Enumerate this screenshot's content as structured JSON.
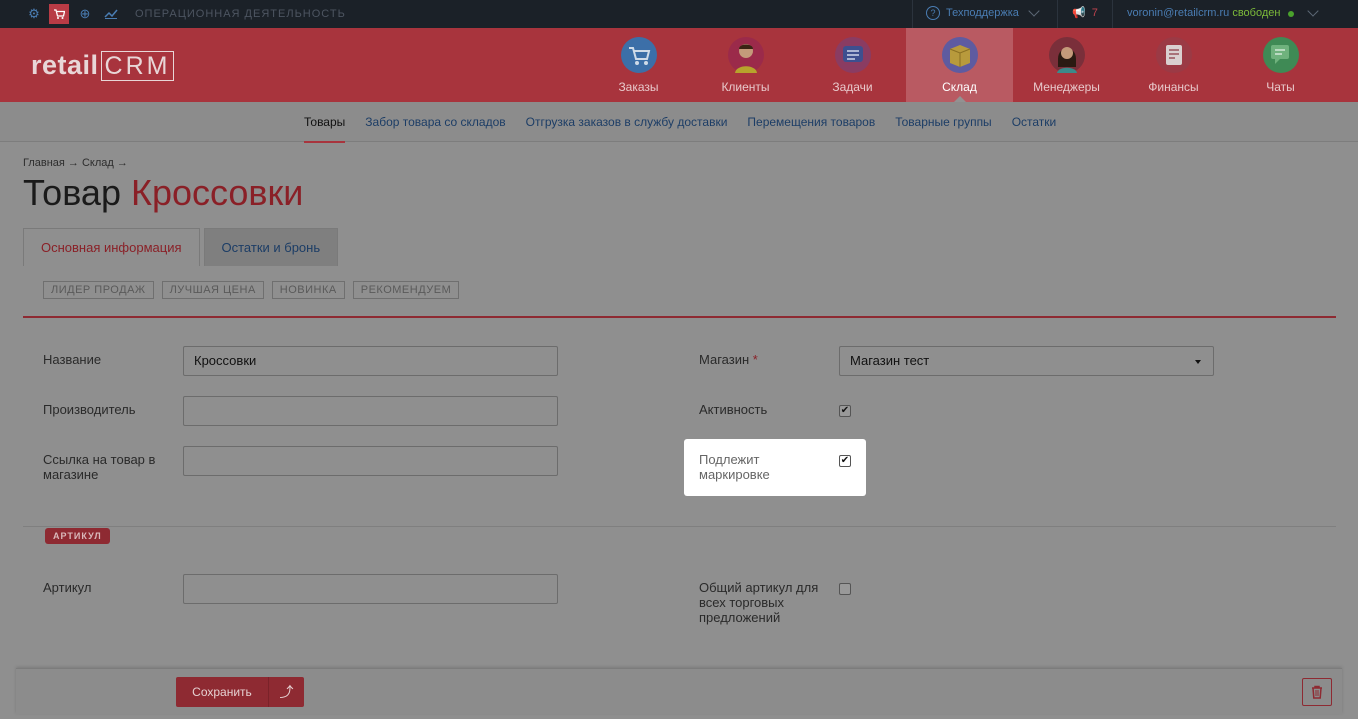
{
  "topbar": {
    "section_title": "ОПЕРАЦИОННАЯ ДЕЯТЕЛЬНОСТЬ",
    "support_label": "Техподдержка",
    "notifications_count": "7",
    "user_email": "voronin@retailcrm.ru",
    "user_status": "свободен"
  },
  "logo": {
    "text": "retail",
    "crm": "CRM"
  },
  "nav": [
    {
      "label": "Заказы",
      "icon": "cart-icon",
      "color": "#3c6fa8"
    },
    {
      "label": "Клиенты",
      "icon": "client-avatar-icon",
      "color": "#9b2a4a"
    },
    {
      "label": "Задачи",
      "icon": "tasks-icon",
      "color": "#8a3c62"
    },
    {
      "label": "Склад",
      "icon": "box-icon",
      "color": "#5e5ba0",
      "active": true
    },
    {
      "label": "Менеджеры",
      "icon": "manager-avatar-icon",
      "color": "#7a2f3a"
    },
    {
      "label": "Финансы",
      "icon": "finance-icon",
      "color": "#9b3a45"
    },
    {
      "label": "Чаты",
      "icon": "chat-icon",
      "color": "#3f8a55"
    }
  ],
  "subnav": [
    "Товары",
    "Забор товара со складов",
    "Отгрузка заказов в службу доставки",
    "Перемещения товаров",
    "Товарные группы",
    "Остатки"
  ],
  "breadcrumb": "Главная → Склад →",
  "page": {
    "title_prefix": "Товар",
    "title_name": "Кроссовки"
  },
  "tabs": [
    "Основная информация",
    "Остатки и бронь"
  ],
  "badges": [
    "ЛИДЕР ПРОДАЖ",
    "ЛУЧШАЯ ЦЕНА",
    "НОВИНКА",
    "РЕКОМЕНДУЕМ"
  ],
  "form": {
    "name_label": "Название",
    "name_value": "Кроссовки",
    "manufacturer_label": "Производитель",
    "manufacturer_value": "",
    "link_label": "Ссылка на товар в магазине",
    "link_value": "",
    "shop_label": "Магазин",
    "shop_required": "*",
    "shop_value": "Магазин тест",
    "active_label": "Активность",
    "active_checked": true,
    "marking_label": "Подлежит маркировке",
    "marking_checked": true,
    "article_section": "АРТИКУЛ",
    "article_label": "Артикул",
    "article_value": "",
    "common_article_label": "Общий артикул для всех торговых предложений",
    "common_article_checked": false
  },
  "footer": {
    "save_label": "Сохранить",
    "save_up_icon": "arrow-up-icon",
    "delete_icon": "trash-icon"
  }
}
